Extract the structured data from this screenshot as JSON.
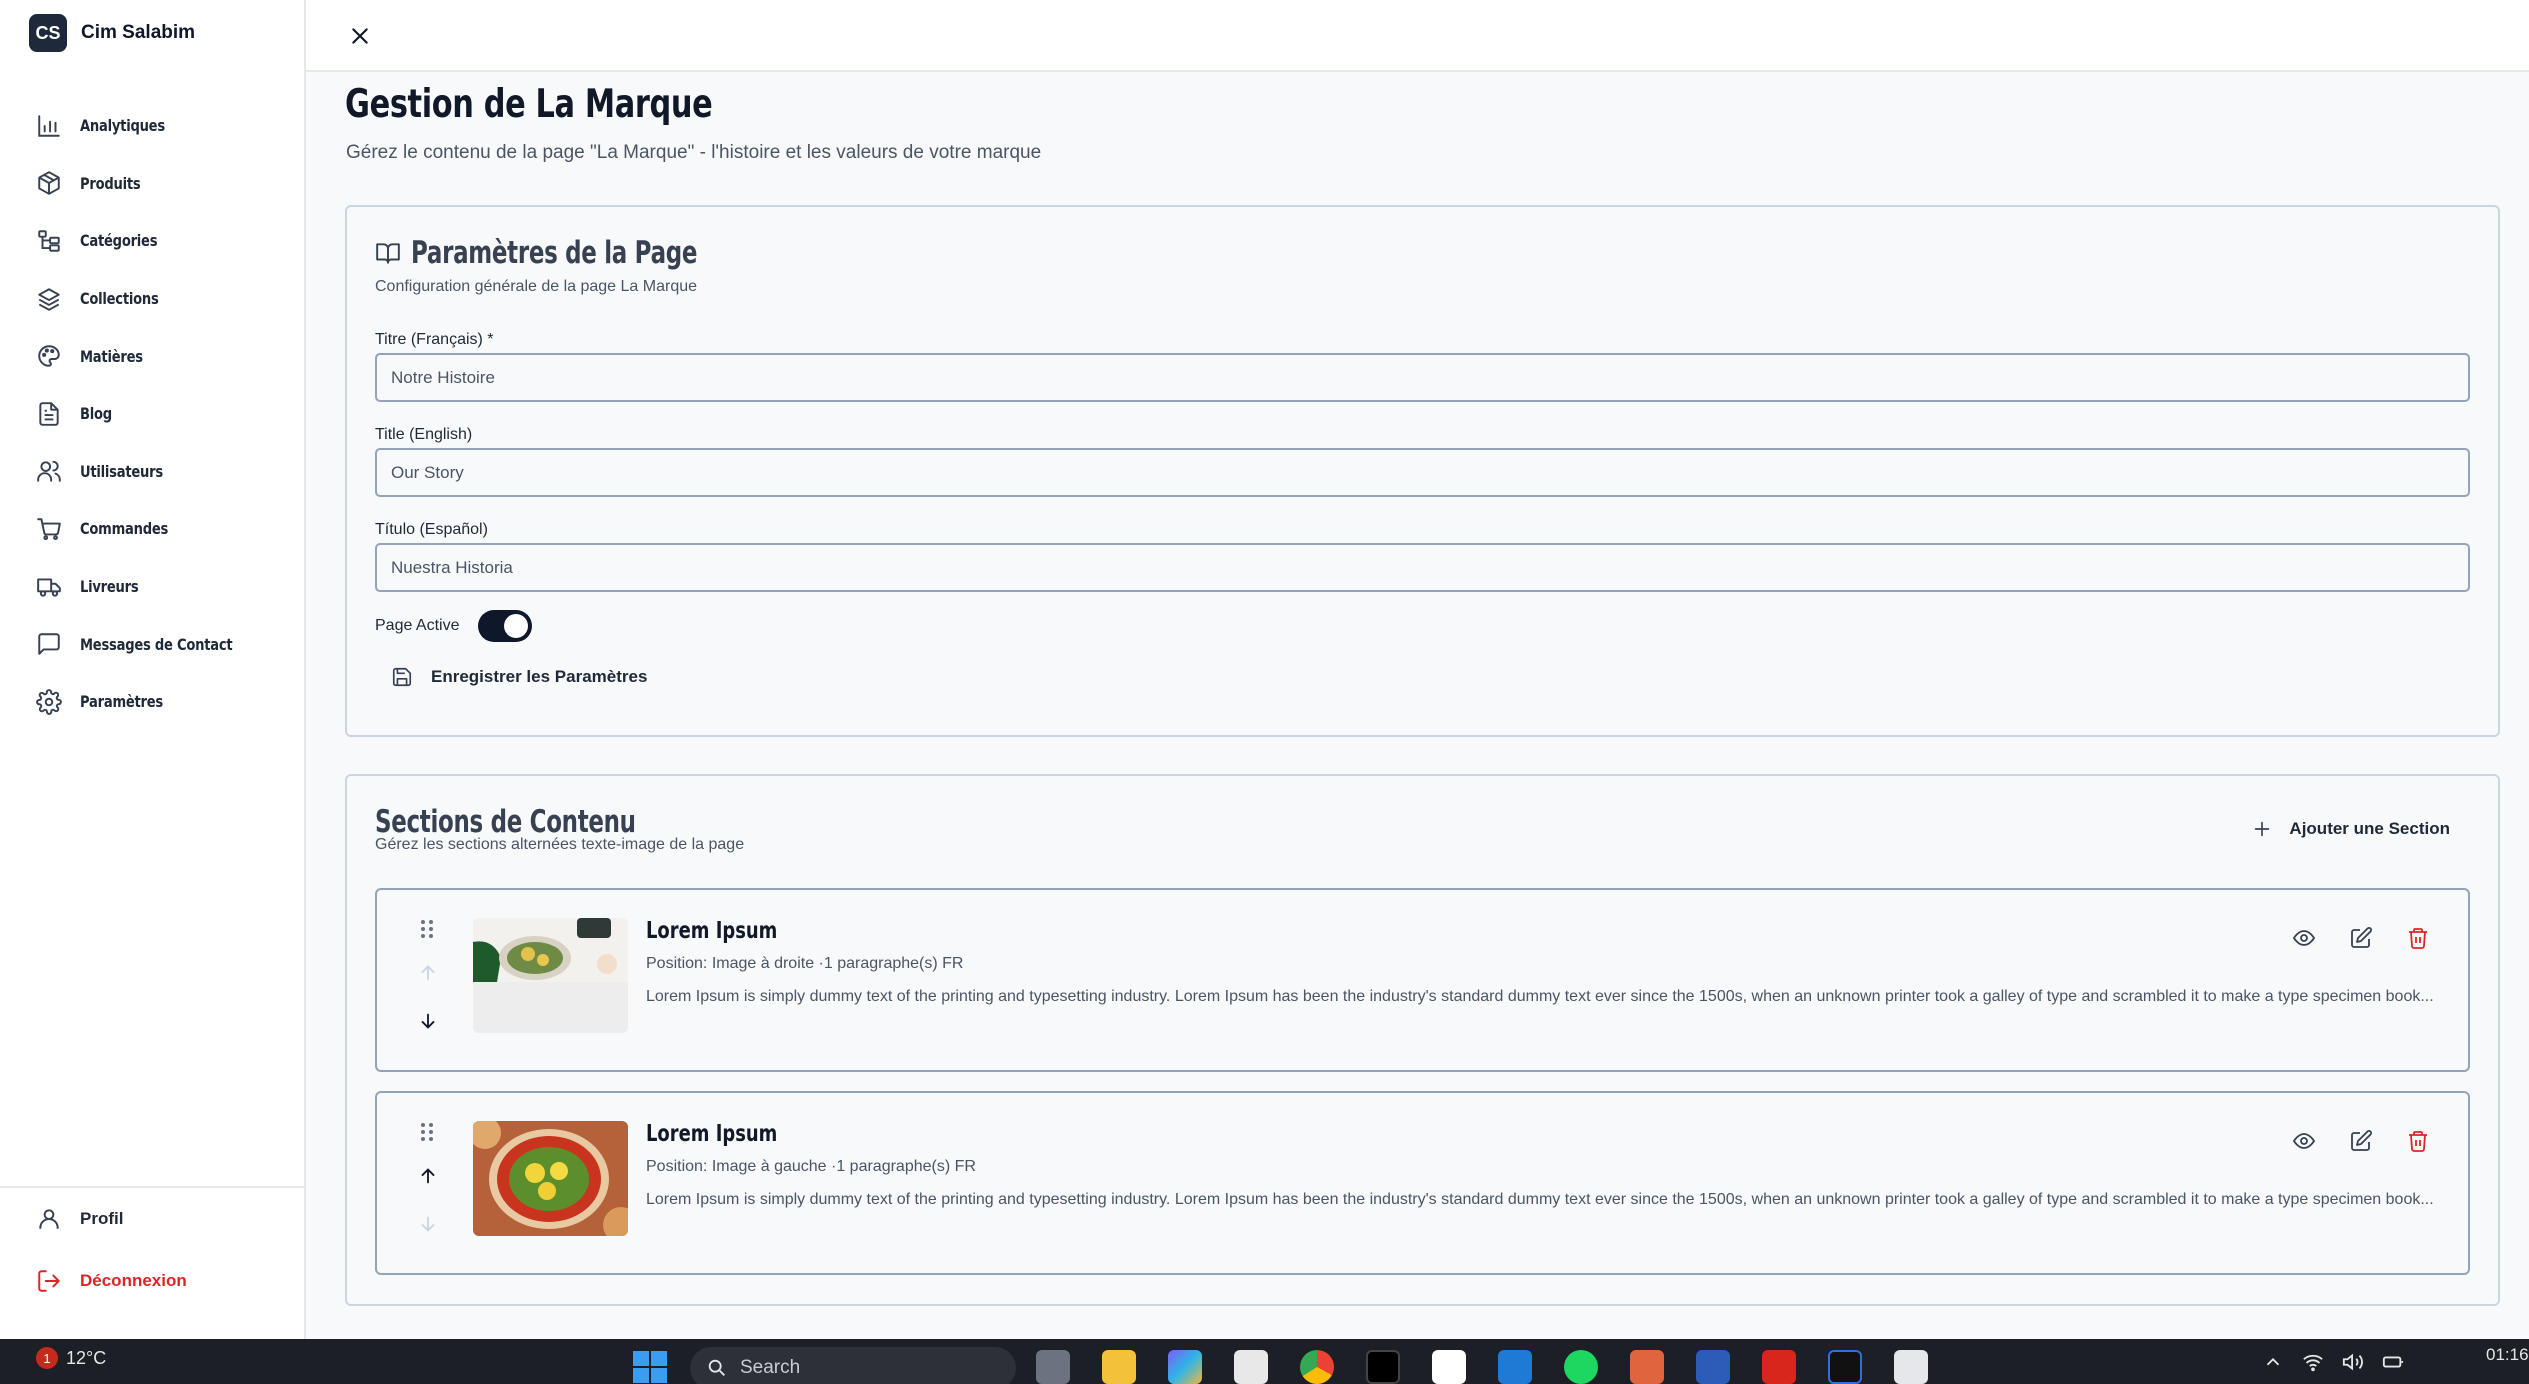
{
  "brand": {
    "initials": "CS",
    "name": "Cim Salabim"
  },
  "sidebar": {
    "items": [
      {
        "label": "Analytiques",
        "icon": "bar-chart-icon"
      },
      {
        "label": "Produits",
        "icon": "package-icon"
      },
      {
        "label": "Catégories",
        "icon": "tree-icon"
      },
      {
        "label": "Collections",
        "icon": "layers-icon"
      },
      {
        "label": "Matières",
        "icon": "palette-icon"
      },
      {
        "label": "Blog",
        "icon": "file-text-icon"
      },
      {
        "label": "Utilisateurs",
        "icon": "users-icon"
      },
      {
        "label": "Commandes",
        "icon": "cart-icon"
      },
      {
        "label": "Livreurs",
        "icon": "truck-icon"
      },
      {
        "label": "Messages de Contact",
        "icon": "message-icon"
      },
      {
        "label": "Paramètres",
        "icon": "gear-icon"
      }
    ],
    "footer": {
      "profile_label": "Profil",
      "logout_label": "Déconnexion"
    }
  },
  "page": {
    "title": "Gestion de La Marque",
    "subtitle": "Gérez le contenu de la page \"La Marque\" - l'histoire et les valeurs de votre marque"
  },
  "settings_card": {
    "title": "Paramètres de la Page",
    "subtitle": "Configuration générale de la page La Marque",
    "fields": [
      {
        "label": "Titre (Français) *",
        "value": "Notre Histoire"
      },
      {
        "label": "Title (English)",
        "value": "Our Story"
      },
      {
        "label": "Título (Español)",
        "value": "Nuestra Historia"
      }
    ],
    "toggle_label": "Page Active",
    "toggle_on": true,
    "save_label": "Enregistrer les Paramètres"
  },
  "sections_card": {
    "title": "Sections de Contenu",
    "subtitle": "Gérez les sections alternées texte-image de la page",
    "add_label": "Ajouter une Section",
    "sections": [
      {
        "title": "Lorem Ipsum",
        "meta": "Position: Image à droite ·1 paragraphe(s) FR",
        "body": "Lorem Ipsum is simply dummy text of the printing and typesetting industry. Lorem Ipsum has been the industry's standard dummy text ever since the 1500s, when an unknown printer took a galley of type and scrambled it to make a type specimen book..."
      },
      {
        "title": "Lorem Ipsum",
        "meta": "Position: Image à gauche ·1 paragraphe(s) FR",
        "body": "Lorem Ipsum is simply dummy text of the printing and typesetting industry. Lorem Ipsum has been the industry's standard dummy text ever since the 1500s, when an unknown printer took a galley of type and scrambled it to make a type specimen book..."
      }
    ]
  },
  "taskbar": {
    "notification_count": "1",
    "temperature": "12°C",
    "search_placeholder": "Search",
    "clock": "01:16"
  },
  "colors": {
    "accent_dark": "#0f172a",
    "danger": "#dc2626",
    "border": "#cbd5e1"
  }
}
